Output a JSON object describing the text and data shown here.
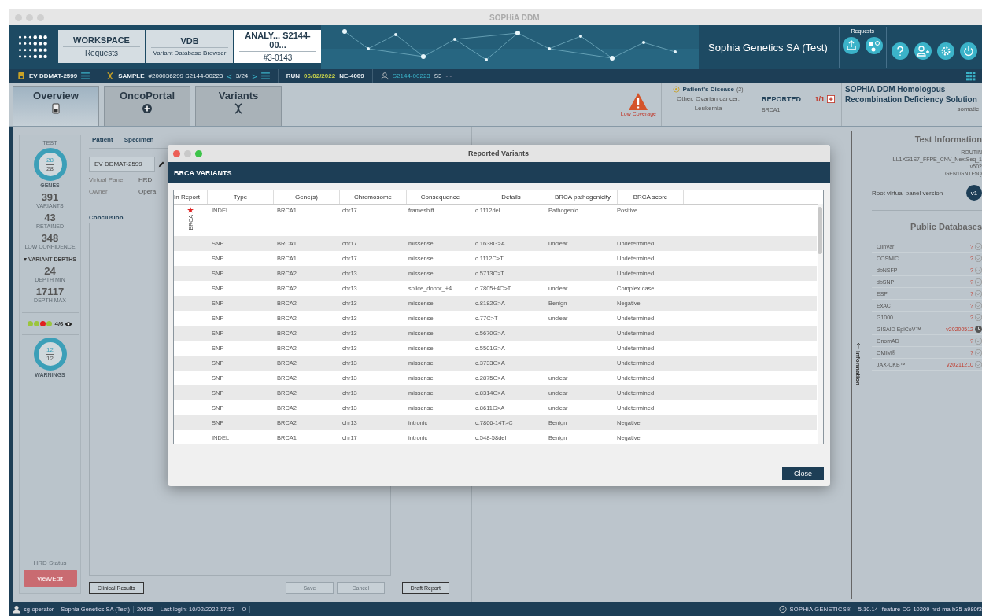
{
  "window": {
    "title": "SOPHiA DDM"
  },
  "nav_tabs": [
    {
      "title": "WORKSPACE",
      "subtitle": "Requests",
      "selected": false
    },
    {
      "title": "VDB",
      "subtitle": "Variant Database Browser",
      "selected": false
    },
    {
      "title": "ANALY... S2144-00...",
      "subtitle": "#3-0143",
      "selected": true
    }
  ],
  "header": {
    "organization": "Sophia Genetics SA (Test)",
    "requests_label": "Requests"
  },
  "context_bar": {
    "case": "EV DDMAT-2599",
    "sample_label": "SAMPLE",
    "sample": "#200036299 S2144-00223",
    "prev": "<",
    "position": "3/24",
    "next": ">",
    "run_label": "RUN",
    "run_date": "06/02/2022",
    "run_id": "NE-4009",
    "user_sample": "S2144-00223",
    "user_suffix": "S3",
    "more": "- -"
  },
  "view_tabs": [
    {
      "label": "Overview",
      "selected": true
    },
    {
      "label": "OncoPortal",
      "selected": false
    },
    {
      "label": "Variants",
      "selected": false
    }
  ],
  "alert": {
    "label": "Low Coverage"
  },
  "disease": {
    "title": "Patient's Disease",
    "count": "(2)",
    "text": "Other, Ovarian cancer, Leukemia"
  },
  "reported": {
    "label": "REPORTED",
    "count": "1/1",
    "gene": "BRCA1"
  },
  "solution": {
    "title": "SOPHiA DDM Homologous Recombination Deficiency Solution",
    "mode": "somatic"
  },
  "stats": {
    "test_label": "TEST",
    "genes": {
      "value": "28",
      "total": "28",
      "label": "GENES"
    },
    "metrics": [
      {
        "value": "391",
        "label": "VARIANTS"
      },
      {
        "value": "43",
        "label": "RETAINED"
      },
      {
        "value": "348",
        "label": "LOW CONFIDENCE"
      }
    ],
    "depths": {
      "label": "VARIANT DEPTHS",
      "expanded": true,
      "metrics": [
        {
          "value": "24",
          "label": "DEPTH MIN"
        },
        {
          "value": "17117",
          "label": "DEPTH MAX"
        }
      ]
    },
    "qc_dots": [
      {
        "color": "#9bc53d"
      },
      {
        "color": "#9bc53d"
      },
      {
        "color": "#e02020"
      },
      {
        "color": "#9bc53d"
      }
    ],
    "qc": "4/6",
    "warnings": {
      "value": "12",
      "total": "12",
      "label": "WARNINGS"
    },
    "hrd_label": "HRD Status",
    "hrd_button": "View/Edit"
  },
  "case_panel": {
    "subtabs": [
      {
        "label": "Patient",
        "selected": false
      },
      {
        "label": "Specimen",
        "selected": false
      }
    ],
    "case_field": "EV DDMAT-2599",
    "fields": [
      {
        "label": "Virtual Panel",
        "value": "HRD_"
      },
      {
        "label": "Owner",
        "value": "Opera"
      }
    ],
    "conclusion_label": "Conclusion",
    "buttons": [
      {
        "label": "Clinical Results",
        "disabled": false
      },
      {
        "label": "Save",
        "disabled": true
      },
      {
        "label": "Cancel",
        "disabled": true
      },
      {
        "label": "Draft Report",
        "disabled": false
      }
    ]
  },
  "info_tab": "Information",
  "test_info": {
    "title": "Test Information",
    "lines": [
      "ROUTIN",
      "ILL1XG1S7_FFPE_CNV_NextSeq_1",
      "v502",
      "GEN1GN1F5Q"
    ],
    "root_label": "Root virtual panel version",
    "root_version": "v1"
  },
  "databases": {
    "title": "Public Databases",
    "items": [
      {
        "name": "ClinVar",
        "version": "?",
        "kind": "check"
      },
      {
        "name": "COSMIC",
        "version": "?",
        "kind": "check"
      },
      {
        "name": "dbNSFP",
        "version": "?",
        "kind": "check"
      },
      {
        "name": "dbSNP",
        "version": "?",
        "kind": "check"
      },
      {
        "name": "ESP",
        "version": "?",
        "kind": "check"
      },
      {
        "name": "ExAC",
        "version": "?",
        "kind": "check"
      },
      {
        "name": "G1000",
        "version": "?",
        "kind": "check"
      },
      {
        "name": "GISAID EpiCoV™",
        "version": "v20200512",
        "kind": "pending"
      },
      {
        "name": "GnomAD",
        "version": "?",
        "kind": "check"
      },
      {
        "name": "OMIM®",
        "version": "?",
        "kind": "check"
      },
      {
        "name": "JAX-CKB™",
        "version": "v20211210",
        "kind": "check"
      }
    ]
  },
  "dialog": {
    "title": "Reported Variants",
    "heading": "BRCA VARIANTS",
    "columns": [
      "In Report",
      "Type",
      "Gene(s)",
      "Chromosome",
      "Consequence",
      "Details",
      "BRCA pathogenicity",
      "BRCA score"
    ],
    "rows": [
      {
        "in_report": true,
        "report_tag": "BRCA",
        "type": "INDEL",
        "genes": "BRCA1",
        "chromosome": "chr17",
        "consequence": "frameshift",
        "details": "c.1112del",
        "pathogenicity": "Pathogenic",
        "score": "Positive"
      },
      {
        "in_report": false,
        "type": "SNP",
        "genes": "BRCA1",
        "chromosome": "chr17",
        "consequence": "missense",
        "details": "c.1638G>A",
        "pathogenicity": "unclear",
        "score": "Undetermined"
      },
      {
        "in_report": false,
        "type": "SNP",
        "genes": "BRCA1",
        "chromosome": "chr17",
        "consequence": "missense",
        "details": "c.1112C>T",
        "score": "Undetermined"
      },
      {
        "in_report": false,
        "type": "SNP",
        "genes": "BRCA2",
        "chromosome": "chr13",
        "consequence": "missense",
        "details": "c.5713C>T",
        "score": "Undetermined"
      },
      {
        "in_report": false,
        "type": "SNP",
        "genes": "BRCA2",
        "chromosome": "chr13",
        "consequence": "splice_donor_+4",
        "details": "c.7805+4C>T",
        "pathogenicity": "unclear",
        "score": "Complex case"
      },
      {
        "in_report": false,
        "type": "SNP",
        "genes": "BRCA2",
        "chromosome": "chr13",
        "consequence": "missense",
        "details": "c.8182G>A",
        "pathogenicity": "Benign",
        "score": "Negative"
      },
      {
        "in_report": false,
        "type": "SNP",
        "genes": "BRCA2",
        "chromosome": "chr13",
        "consequence": "missense",
        "details": "c.77C>T",
        "pathogenicity": "unclear",
        "score": "Undetermined"
      },
      {
        "in_report": false,
        "type": "SNP",
        "genes": "BRCA2",
        "chromosome": "chr13",
        "consequence": "missense",
        "details": "c.5670G>A",
        "score": "Undetermined"
      },
      {
        "in_report": false,
        "type": "SNP",
        "genes": "BRCA2",
        "chromosome": "chr13",
        "consequence": "missense",
        "details": "c.5501G>A",
        "score": "Undetermined"
      },
      {
        "in_report": false,
        "type": "SNP",
        "genes": "BRCA2",
        "chromosome": "chr13",
        "consequence": "missense",
        "details": "c.3733G>A",
        "score": "Undetermined"
      },
      {
        "in_report": false,
        "type": "SNP",
        "genes": "BRCA2",
        "chromosome": "chr13",
        "consequence": "missense",
        "details": "c.2875G>A",
        "pathogenicity": "unclear",
        "score": "Undetermined"
      },
      {
        "in_report": false,
        "type": "SNP",
        "genes": "BRCA2",
        "chromosome": "chr13",
        "consequence": "missense",
        "details": "c.8314G>A",
        "pathogenicity": "unclear",
        "score": "Undetermined"
      },
      {
        "in_report": false,
        "type": "SNP",
        "genes": "BRCA2",
        "chromosome": "chr13",
        "consequence": "missense",
        "details": "c.8611G>A",
        "pathogenicity": "unclear",
        "score": "Undetermined"
      },
      {
        "in_report": false,
        "type": "SNP",
        "genes": "BRCA2",
        "chromosome": "chr13",
        "consequence": "intronic",
        "details": "c.7806-14T>C",
        "pathogenicity": "Benign",
        "score": "Negative"
      },
      {
        "in_report": false,
        "type": "INDEL",
        "genes": "BRCA1",
        "chromosome": "chr17",
        "consequence": "intronic",
        "details": "c.548-58del",
        "pathogenicity": "Benign",
        "score": "Negative"
      }
    ],
    "close": "Close"
  },
  "status_bar": {
    "user": "sg-operator",
    "organization": "Sophia Genetics SA (Test)",
    "id": "20695",
    "last_login": "Last login: 10/02/2022 17:57",
    "flag": "O",
    "brand": "SOPHiA GENETICS®",
    "version": "5.10.14--feature-DG-10209-hrd-ma-b35-a980f3"
  }
}
